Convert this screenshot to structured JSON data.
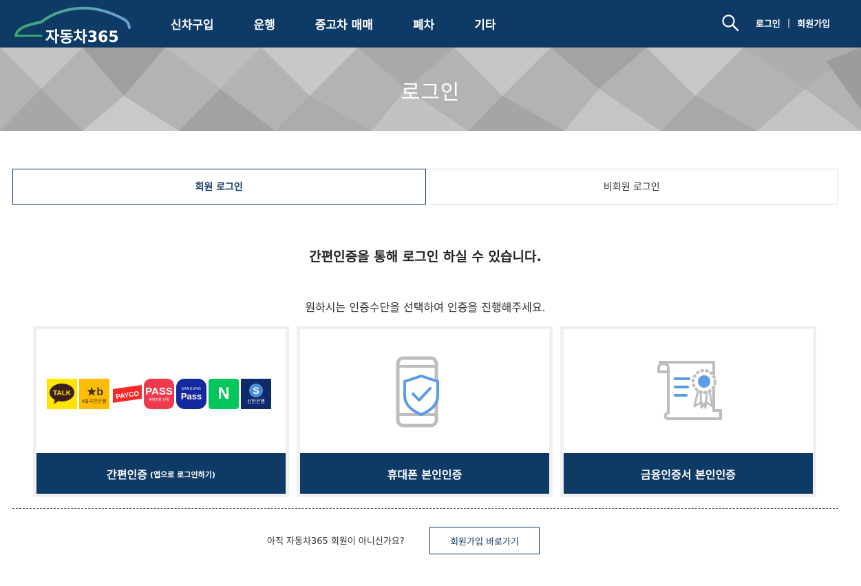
{
  "header": {
    "logo_text": "자동차365",
    "nav": [
      "신차구입",
      "운행",
      "중고차 매매",
      "폐차",
      "기타"
    ],
    "login_label": "로그인",
    "separator": "|",
    "signup_label": "회원가입",
    "bg_color": "#0e3a66"
  },
  "banner": {
    "title": "로그인"
  },
  "tabs": {
    "member": "회원 로그인",
    "guest": "비회원 로그인"
  },
  "main": {
    "headline": "간편인증을 통해 로그인 하실 수 있습니다.",
    "subline": "원하시는 인증수단을 선택하여 인증을 진행해주세요."
  },
  "cards": {
    "simple": {
      "label": "간편인증",
      "sublabel": "(앱으로 로그인하기)",
      "logos": {
        "kakao": "TALK",
        "kb": "KB국민은행",
        "payco": "PAYCO",
        "pass": "PASS",
        "pass_sub": "휴대전화 인증",
        "samsung_top": "SAMSUNG",
        "samsung": "Pass",
        "naver": "N",
        "shinhan": "신한은행"
      }
    },
    "phone": {
      "label": "휴대폰 본인인증"
    },
    "cert": {
      "label": "금융인증서 본인인증"
    }
  },
  "footer": {
    "question": "아직 자동차365 회원이 아니신가요?",
    "join_button": "회원가입 바로가기"
  }
}
